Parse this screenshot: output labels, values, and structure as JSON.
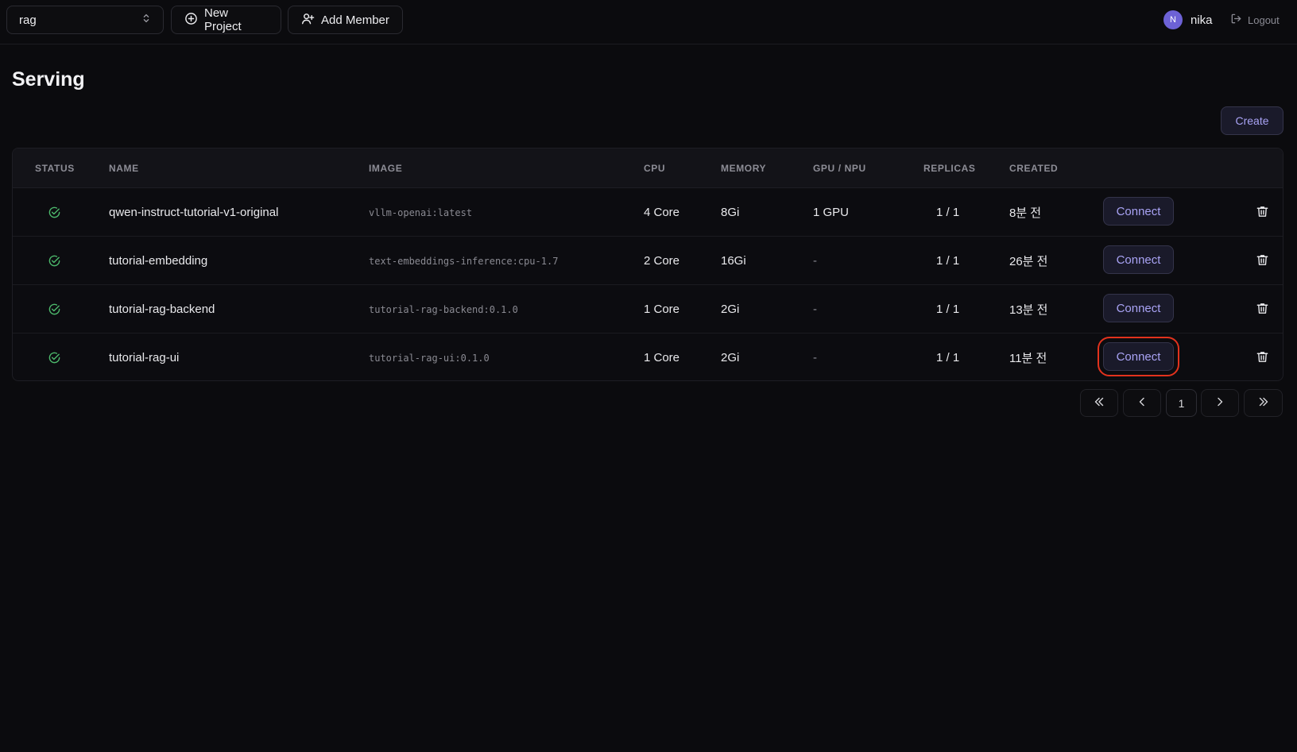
{
  "topbar": {
    "project_select": {
      "value": "rag"
    },
    "new_project_label": "New Project",
    "add_member_label": "Add Member",
    "user": {
      "initial": "N",
      "name": "nika"
    },
    "logout_label": "Logout"
  },
  "page": {
    "title": "Serving",
    "create_label": "Create"
  },
  "table": {
    "headers": {
      "status": "STATUS",
      "name": "NAME",
      "image": "IMAGE",
      "cpu": "CPU",
      "memory": "MEMORY",
      "gpu": "GPU / NPU",
      "replicas": "REPLICAS",
      "created": "CREATED"
    },
    "rows": [
      {
        "name": "qwen-instruct-tutorial-v1-original",
        "image": "vllm-openai:latest",
        "cpu": "4 Core",
        "memory": "8Gi",
        "gpu": "1 GPU",
        "replicas": "1 / 1",
        "created": "8분 전",
        "action": "Connect"
      },
      {
        "name": "tutorial-embedding",
        "image": "text-embeddings-inference:cpu-1.7",
        "cpu": "2 Core",
        "memory": "16Gi",
        "gpu": "-",
        "replicas": "1 / 1",
        "created": "26분 전",
        "action": "Connect"
      },
      {
        "name": "tutorial-rag-backend",
        "image": "tutorial-rag-backend:0.1.0",
        "cpu": "1 Core",
        "memory": "2Gi",
        "gpu": "-",
        "replicas": "1 / 1",
        "created": "13분 전",
        "action": "Connect"
      },
      {
        "name": "tutorial-rag-ui",
        "image": "tutorial-rag-ui:0.1.0",
        "cpu": "1 Core",
        "memory": "2Gi",
        "gpu": "-",
        "replicas": "1 / 1",
        "created": "11분 전",
        "action": "Connect"
      }
    ]
  },
  "pagination": {
    "current_page": "1"
  },
  "colors": {
    "accent": "#a9a3f5",
    "status_ok": "#4cb86b",
    "highlight": "#e2321d"
  }
}
